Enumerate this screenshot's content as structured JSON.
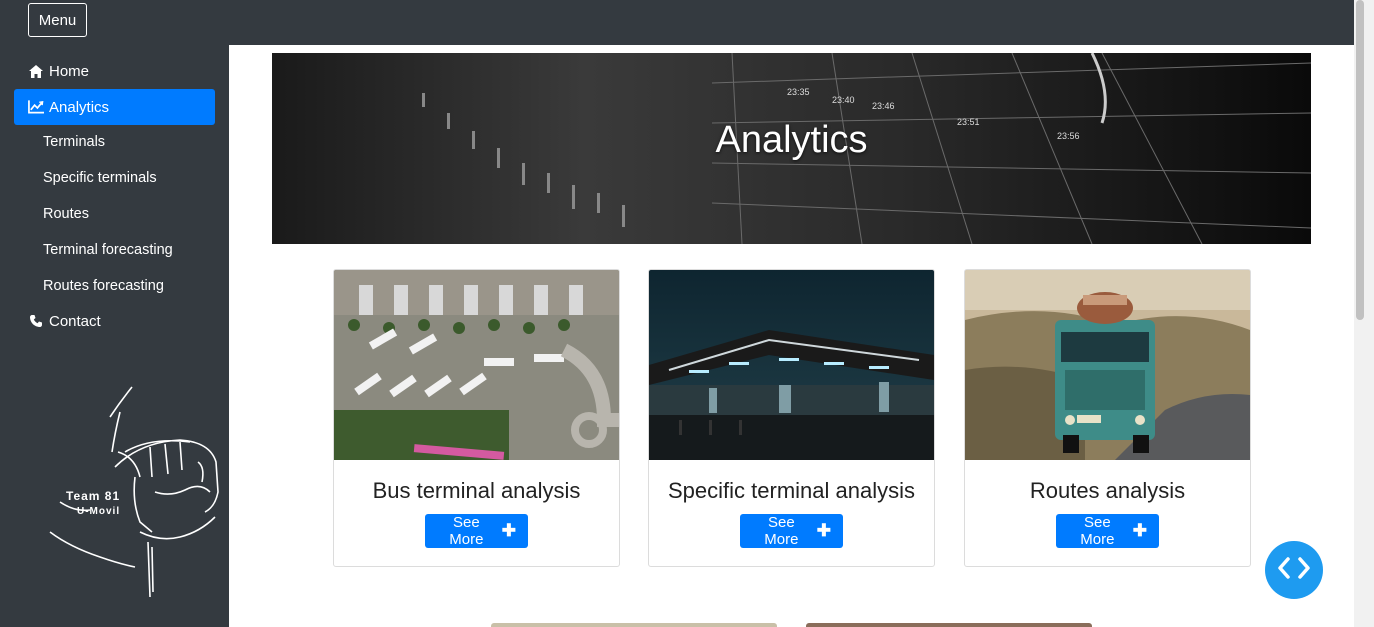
{
  "topbar": {
    "menu_label": "Menu"
  },
  "sidebar": {
    "items": [
      {
        "label": "Home",
        "icon": "home-icon"
      },
      {
        "label": "Analytics",
        "icon": "chart-line-icon",
        "active": true
      },
      {
        "label": "Terminals"
      },
      {
        "label": "Specific terminals"
      },
      {
        "label": "Routes"
      },
      {
        "label": "Terminal forecasting"
      },
      {
        "label": "Routes forecasting"
      },
      {
        "label": "Contact",
        "icon": "phone-icon"
      }
    ],
    "logo": {
      "line1": "Team 81",
      "line2": "U-Movil"
    }
  },
  "hero": {
    "title": "Analytics"
  },
  "cards": [
    {
      "title": "Bus terminal analysis",
      "button": "See More"
    },
    {
      "title": "Specific terminal analysis",
      "button": "See More"
    },
    {
      "title": "Routes analysis",
      "button": "See More"
    }
  ],
  "colors": {
    "accent": "#007bff",
    "sidebar": "#343a40",
    "fab": "#1e9bf0"
  }
}
